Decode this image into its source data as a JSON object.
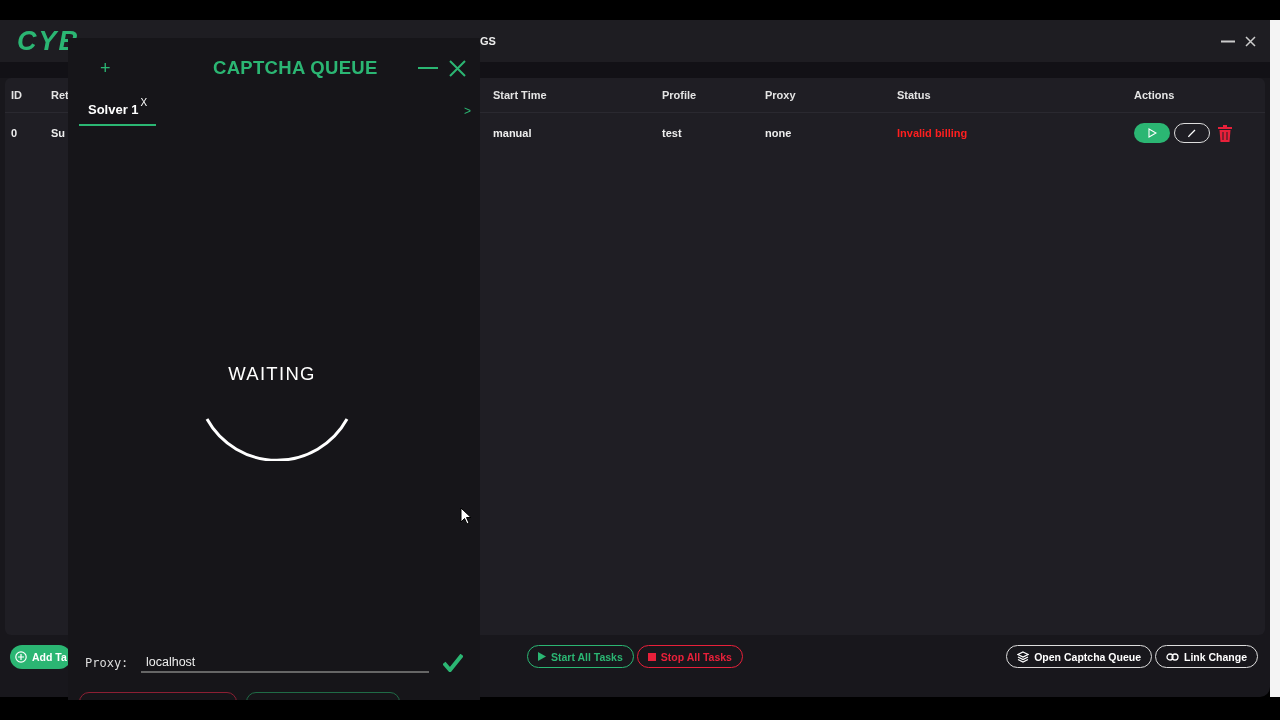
{
  "app": {
    "logo": "CYB",
    "nav_partial": "GS"
  },
  "table": {
    "columns": [
      "ID",
      "Ret",
      "Start Time",
      "Profile",
      "Proxy",
      "Status",
      "Actions"
    ],
    "rows": [
      {
        "cells": [
          "0",
          "Su",
          "manual",
          "test",
          "none",
          "Invalid billing"
        ]
      }
    ]
  },
  "footer": {
    "add_button": "Add Ta",
    "buttons": [
      {
        "label": "Start All Tasks",
        "kind": "start"
      },
      {
        "label": "Stop All Tasks",
        "kind": "stop"
      },
      {
        "label": "Open Captcha Queue",
        "kind": "queue"
      },
      {
        "label": "Link Change",
        "kind": "link"
      }
    ]
  },
  "captcha": {
    "add": "+",
    "title": "CAPTCHA QUEUE",
    "tabs": [
      {
        "label": "Solver 1",
        "close": "X",
        "selected": true
      }
    ],
    "next": ">",
    "status": "WAITING",
    "proxy_label": "Proxy:",
    "proxy_value": "localhost"
  }
}
